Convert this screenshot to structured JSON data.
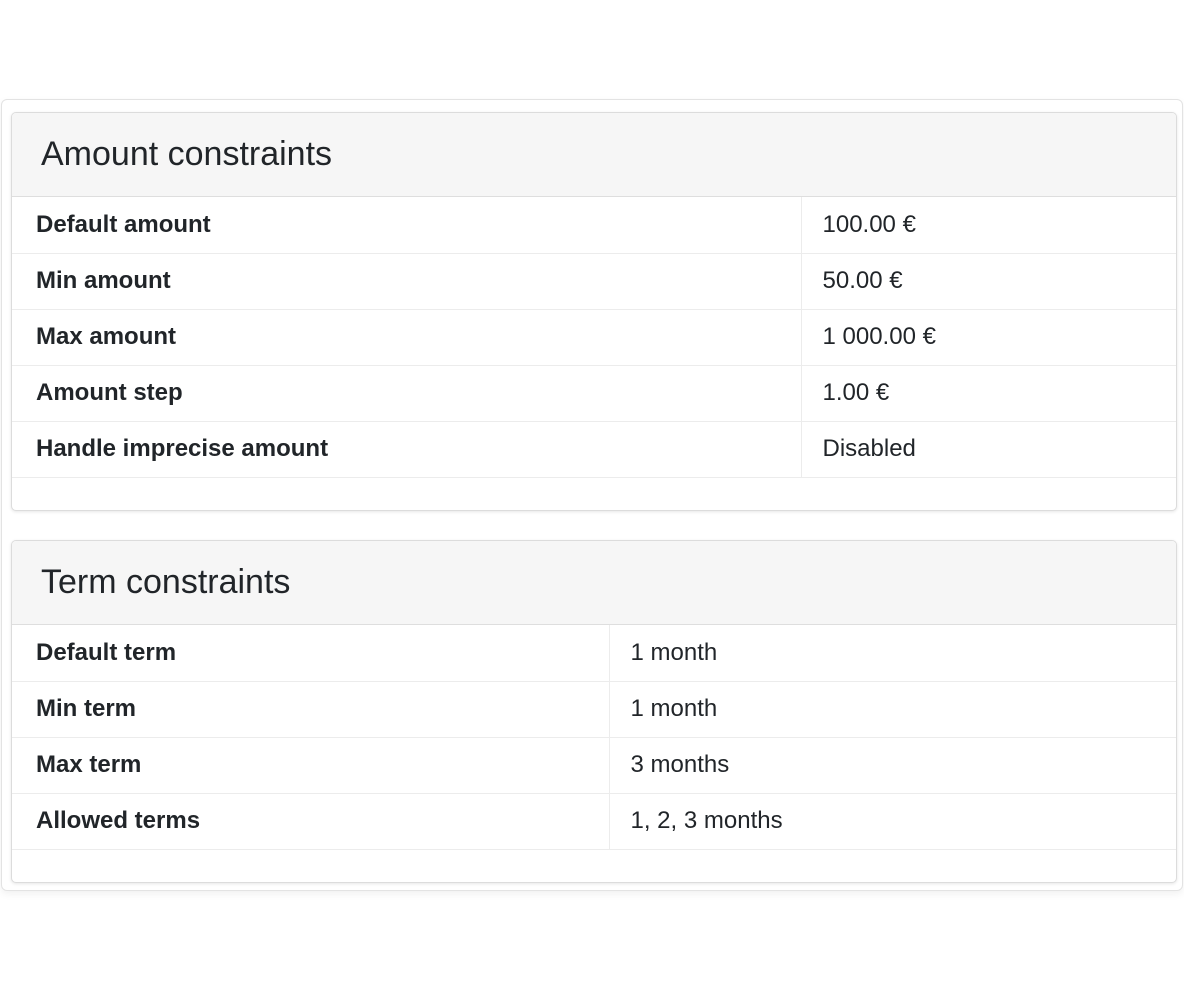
{
  "amount_constraints": {
    "title": "Amount constraints",
    "rows": [
      {
        "label": "Default amount",
        "value": "100.00 €"
      },
      {
        "label": "Min amount",
        "value": "50.00 €"
      },
      {
        "label": "Max amount",
        "value": "1 000.00 €"
      },
      {
        "label": "Amount step",
        "value": "1.00 €"
      },
      {
        "label": "Handle imprecise amount",
        "value": "Disabled"
      }
    ]
  },
  "term_constraints": {
    "title": "Term constraints",
    "rows": [
      {
        "label": "Default term",
        "value": "1 month"
      },
      {
        "label": "Min term",
        "value": "1 month"
      },
      {
        "label": "Max term",
        "value": "3 months"
      },
      {
        "label": "Allowed terms",
        "value": "1, 2, 3 months"
      }
    ]
  }
}
